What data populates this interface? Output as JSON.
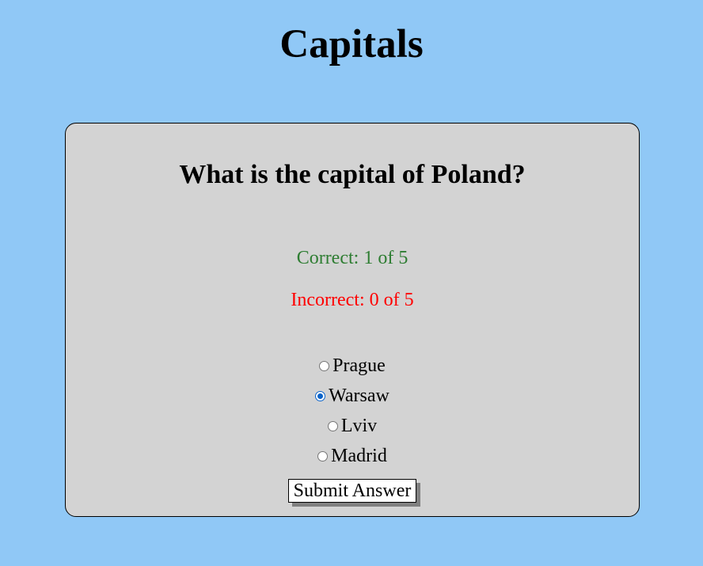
{
  "page": {
    "title": "Capitals"
  },
  "quiz": {
    "question": "What is the capital of Poland?",
    "correct_text": "Correct: 1 of 5",
    "incorrect_text": "Incorrect: 0 of 5",
    "options": [
      {
        "label": "Prague",
        "selected": false
      },
      {
        "label": "Warsaw",
        "selected": true
      },
      {
        "label": "Lviv",
        "selected": false
      },
      {
        "label": "Madrid",
        "selected": false
      }
    ],
    "submit_label": "Submit Answer"
  },
  "colors": {
    "background": "#90c8f6",
    "card": "#d3d3d3",
    "correct": "#2e7d32",
    "incorrect": "#ff0000",
    "radio_selected": "#0a63c9"
  }
}
